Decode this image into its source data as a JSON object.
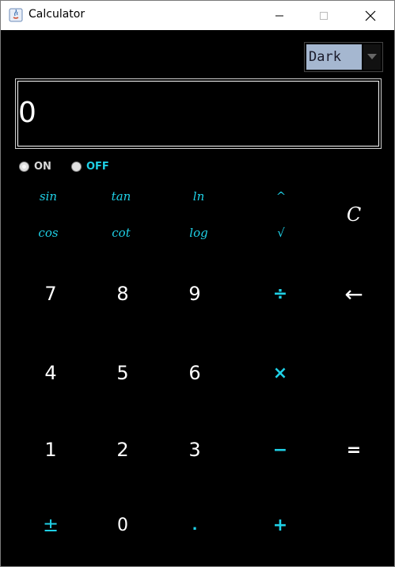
{
  "window": {
    "title": "Calculator"
  },
  "theme_select": {
    "value": "Dark"
  },
  "display": {
    "value": "0"
  },
  "power": {
    "on_label": "ON",
    "off_label": "OFF",
    "selected": "ON"
  },
  "scientific": {
    "sin": "sin",
    "tan": "tan",
    "ln": "ln",
    "power": "^",
    "cos": "cos",
    "cot": "cot",
    "log": "log",
    "sqrt": "√",
    "clear": "C"
  },
  "keypad": {
    "seven": "7",
    "eight": "8",
    "nine": "9",
    "divide": "÷",
    "backspace": "←",
    "four": "4",
    "five": "5",
    "six": "6",
    "multiply": "×",
    "one": "1",
    "two": "2",
    "three": "3",
    "minus": "−",
    "equals": "=",
    "plus_minus": "±",
    "zero": "0",
    "decimal": ".",
    "plus": "+"
  },
  "colors": {
    "accent": "#1fd0e6",
    "background": "#000000",
    "select_bg": "#a5b7d0"
  }
}
